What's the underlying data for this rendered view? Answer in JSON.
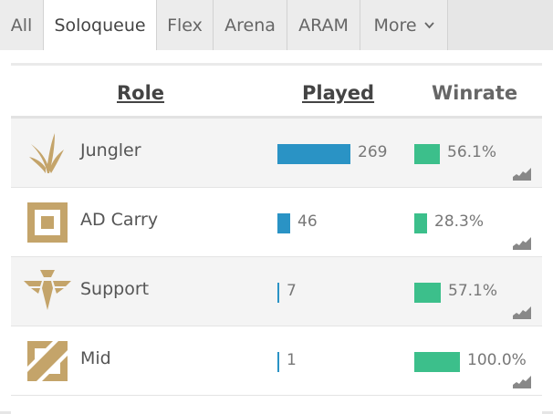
{
  "tabs": [
    {
      "label": "All",
      "active": false
    },
    {
      "label": "Soloqueue",
      "active": true
    },
    {
      "label": "Flex",
      "active": false
    },
    {
      "label": "Arena",
      "active": false
    },
    {
      "label": "ARAM",
      "active": false
    },
    {
      "label": "More",
      "active": false,
      "icon": "chevron-down-icon"
    }
  ],
  "table": {
    "headers": {
      "role": "Role",
      "played": "Played",
      "winrate": "Winrate"
    },
    "rows": [
      {
        "role": "Jungler",
        "icon": "jungle-role-icon",
        "played": "269",
        "played_value": 269,
        "winrate": "56.1%",
        "winrate_value": 56.1
      },
      {
        "role": "AD Carry",
        "icon": "adc-role-icon",
        "played": "46",
        "played_value": 46,
        "winrate": "28.3%",
        "winrate_value": 28.3
      },
      {
        "role": "Support",
        "icon": "support-role-icon",
        "played": "7",
        "played_value": 7,
        "winrate": "57.1%",
        "winrate_value": 57.1
      },
      {
        "role": "Mid",
        "icon": "mid-role-icon",
        "played": "1",
        "played_value": 1,
        "winrate": "100.0%",
        "winrate_value": 100.0
      }
    ]
  },
  "colors": {
    "played_bar": "#2a93c5",
    "winrate_bar": "#3cbf8b",
    "role_icon": "#c4a46a"
  }
}
